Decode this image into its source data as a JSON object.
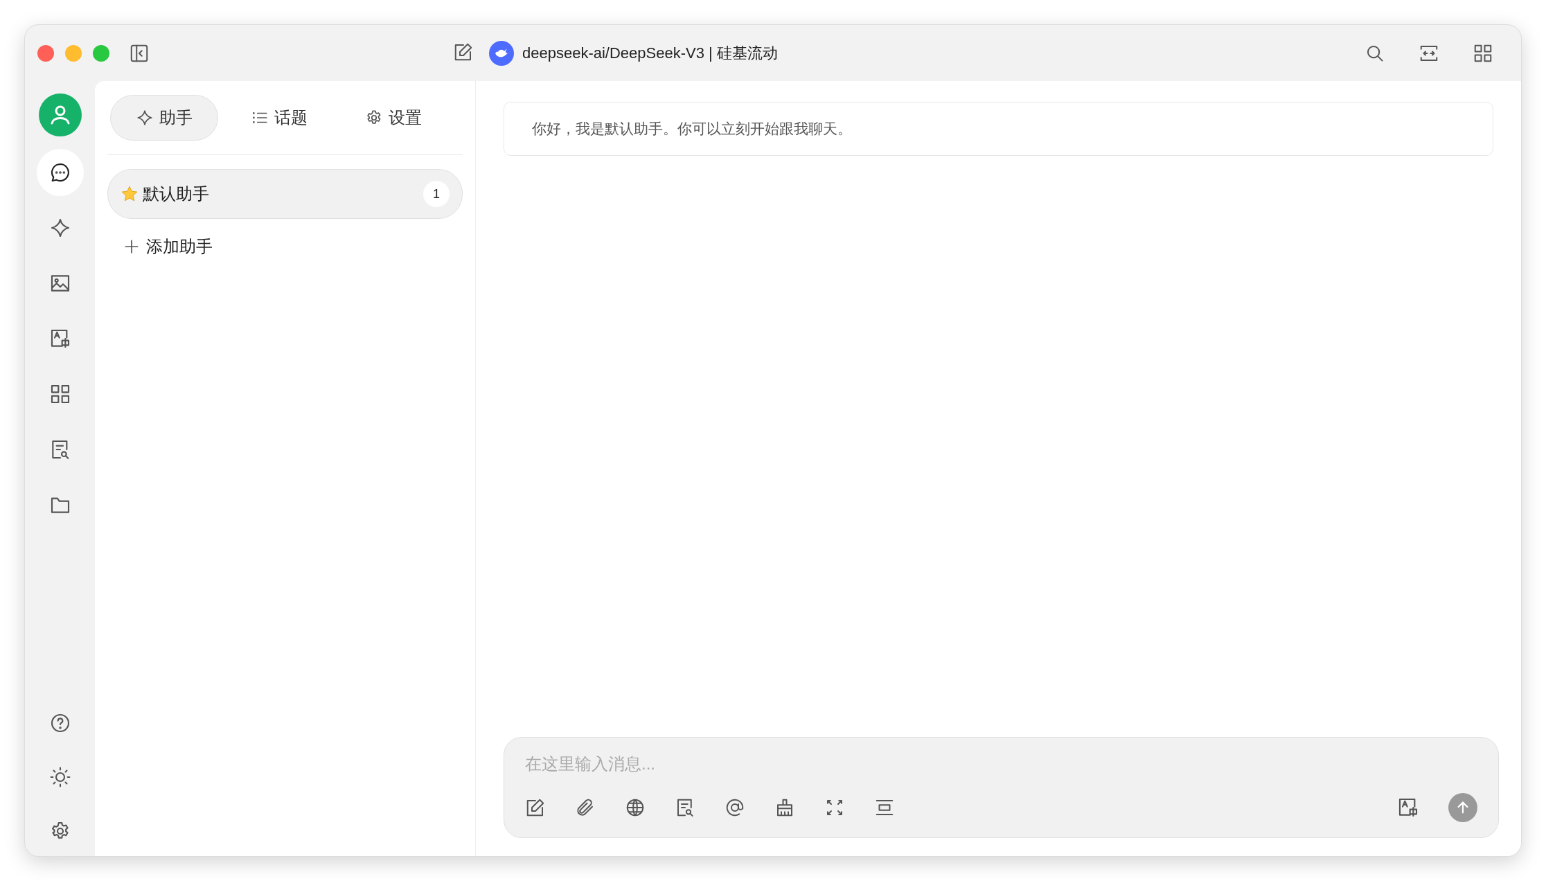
{
  "window": {
    "title": "deepseek-ai/DeepSeek-V3 | 硅基流动"
  },
  "rail": {
    "items": [
      {
        "selected": true
      },
      {
        "selected": false
      },
      {
        "selected": false
      },
      {
        "selected": false
      },
      {
        "selected": false
      },
      {
        "selected": false
      },
      {
        "selected": false
      }
    ]
  },
  "tabs": [
    {
      "label": "助手",
      "selected": true
    },
    {
      "label": "话题",
      "selected": false
    },
    {
      "label": "设置",
      "selected": false
    }
  ],
  "assistants": [
    {
      "name": "默认助手",
      "count": "1",
      "selected": true
    }
  ],
  "add_assistant": "添加助手",
  "messages": [
    {
      "text": "你好，我是默认助手。你可以立刻开始跟我聊天。"
    }
  ],
  "input": {
    "placeholder": "在这里输入消息..."
  }
}
